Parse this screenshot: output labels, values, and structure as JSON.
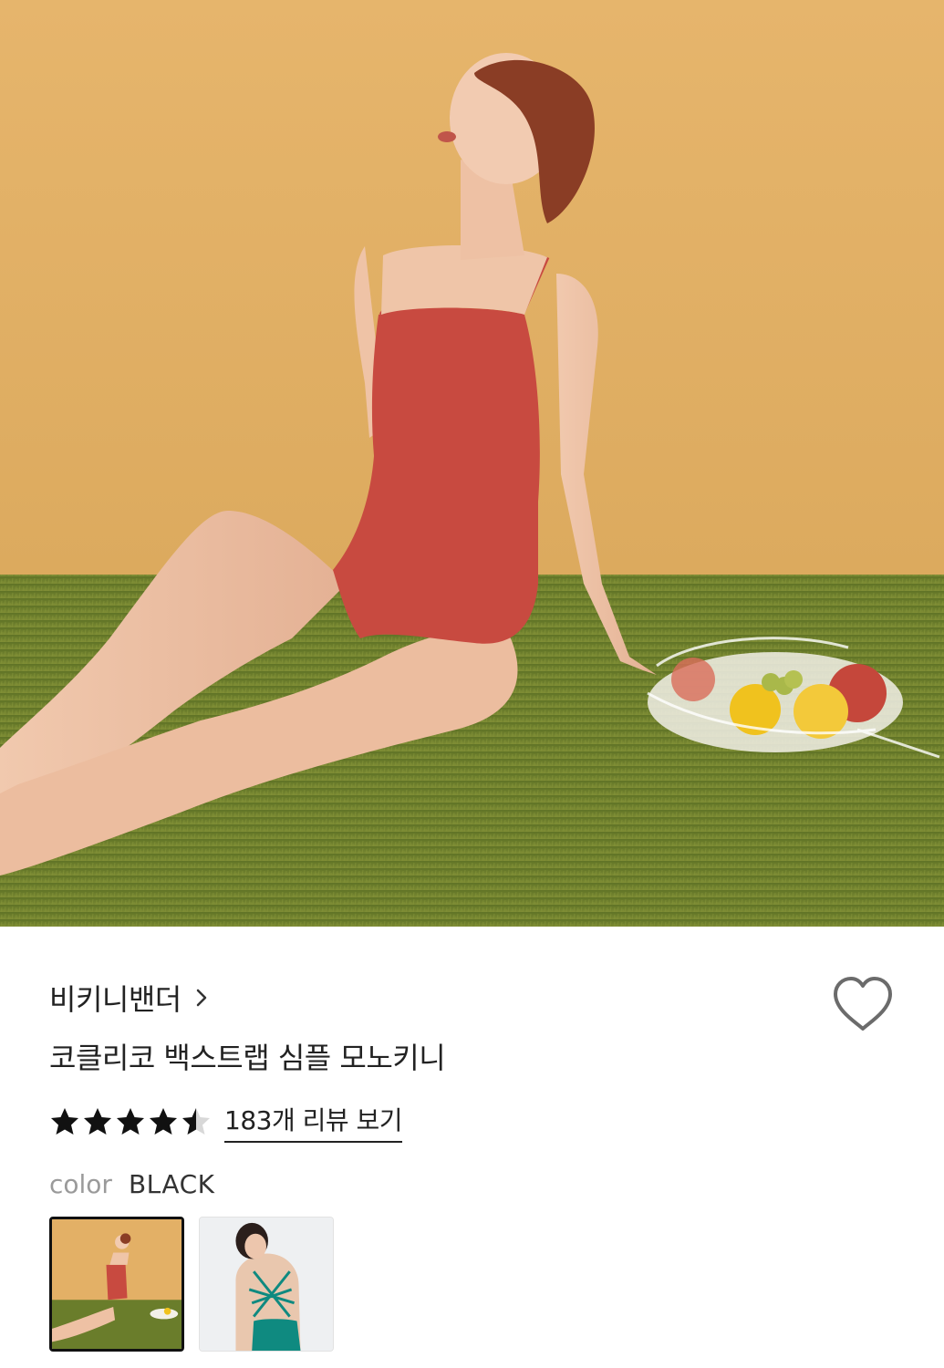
{
  "product": {
    "brand": "비키니밴더",
    "title": "코클리코 백스트랩 심플 모노키니",
    "rating": 4.5,
    "rating_max": 5,
    "review_link": "183개 리뷰 보기"
  },
  "color": {
    "label": "color",
    "value": "BLACK"
  },
  "swatches": [
    {
      "selected": true
    },
    {
      "selected": false
    }
  ],
  "colors": {
    "wall": "#e3b066",
    "grass": "#6f7f2c",
    "swimsuit": "#c84a40",
    "teal_swimsuit": "#0f8a80",
    "text": "#222222",
    "muted": "#9a9a9a"
  }
}
